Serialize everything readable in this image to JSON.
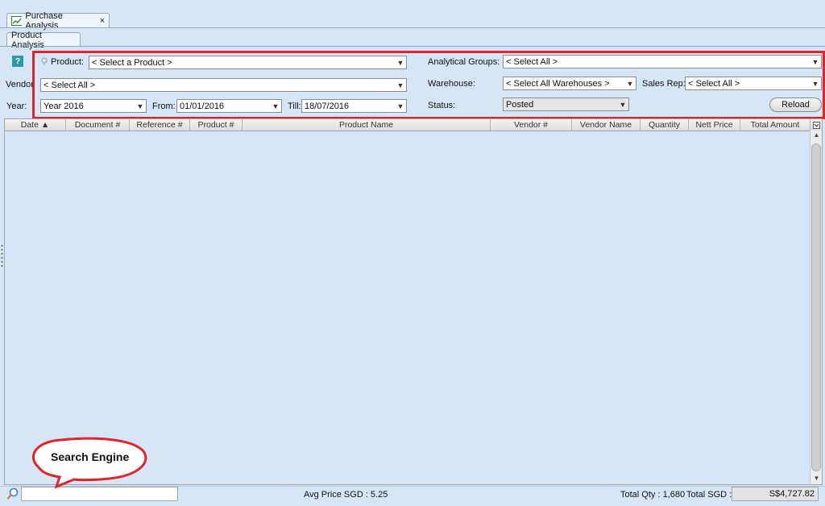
{
  "tabs": {
    "outer_tab_label": "Purchase Analysis",
    "close_glyph": "×",
    "inner_tab_label": "Product Analysis"
  },
  "filters": {
    "help_glyph": "?",
    "product_label": "Product:",
    "product_value": "< Select a Product >",
    "analytical_groups_label": "Analytical Groups:",
    "analytical_groups_value": "< Select All >",
    "vendor_label": "Vendor",
    "vendor_value": "< Select All >",
    "warehouse_label": "Warehouse:",
    "warehouse_value": "< Select All Warehouses >",
    "sales_rep_label": "Sales Rep:",
    "sales_rep_value": "< Select All >",
    "year_label": "Year:",
    "year_value": "Year 2016",
    "from_label": "From:",
    "from_value": "01/01/2016",
    "till_label": "Till:",
    "till_value": "18/07/2016",
    "status_label": "Status:",
    "status_value": "Posted",
    "reload_label": "Reload"
  },
  "grid": {
    "columns": [
      "Date ▲",
      "Document #",
      "Reference #",
      "Product #",
      "Product Name",
      "Vendor #",
      "Vendor Name",
      "Quantity",
      "Nett Price",
      "Total Amount"
    ]
  },
  "footer": {
    "avg_price": "Avg Price SGD : 5.25",
    "total_qty": "Total Qty : 1,680",
    "total_sgd_label": "Total SGD :",
    "total_sgd_value": "S$4,727.82"
  },
  "annotation": {
    "callout_text": "Search Engine"
  },
  "colors": {
    "background": "#d6e6f6",
    "highlight_red": "#e0242c"
  }
}
